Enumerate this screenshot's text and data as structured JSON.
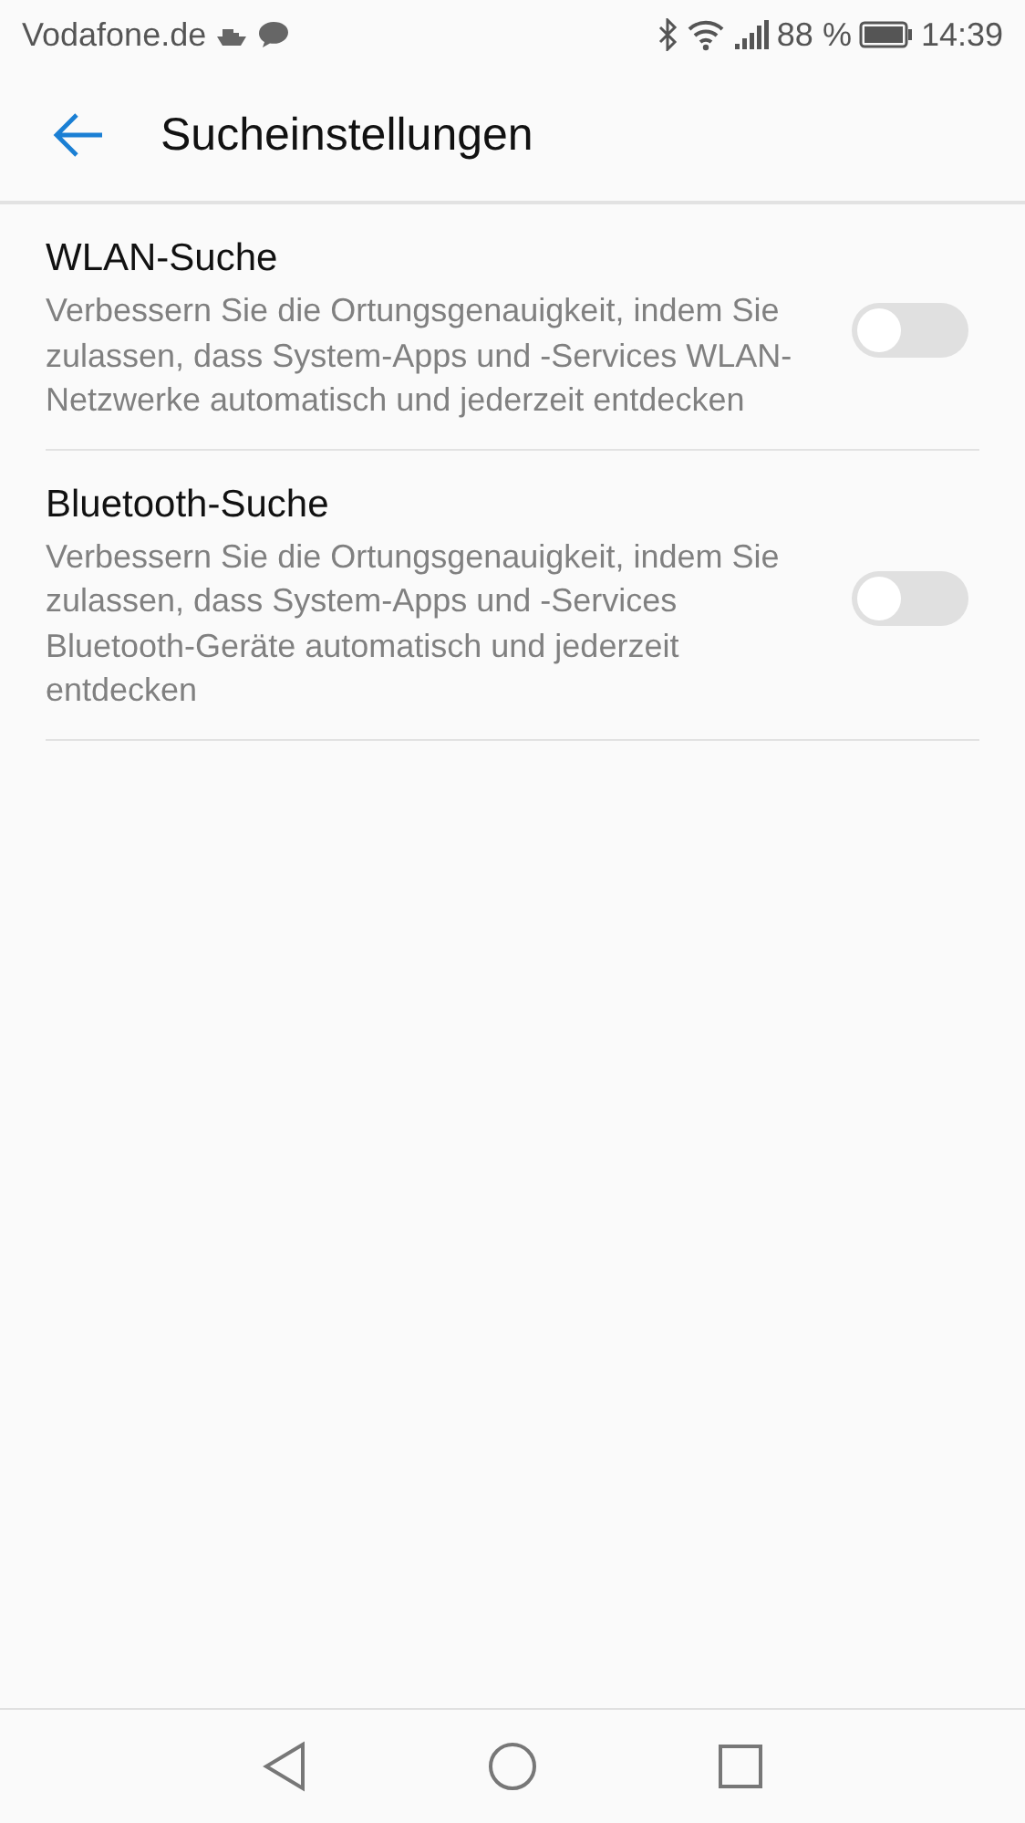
{
  "status_bar": {
    "carrier": "Vodafone.de",
    "battery": "88 %",
    "time": "14:39"
  },
  "header": {
    "title": "Sucheinstellungen"
  },
  "settings": [
    {
      "title": "WLAN-Suche",
      "description": "Verbessern Sie die Ortungsgenauigkeit, indem Sie zulassen, dass System-Apps und -Services WLAN-Netzwerke automatisch und jederzeit entdecken",
      "on": false
    },
    {
      "title": "Bluetooth-Suche",
      "description": "Verbessern Sie die Ortungsgenauigkeit, indem Sie zulassen, dass System-Apps und -Services Bluetooth-Geräte automatisch und jederzeit entdecken",
      "on": false
    }
  ]
}
